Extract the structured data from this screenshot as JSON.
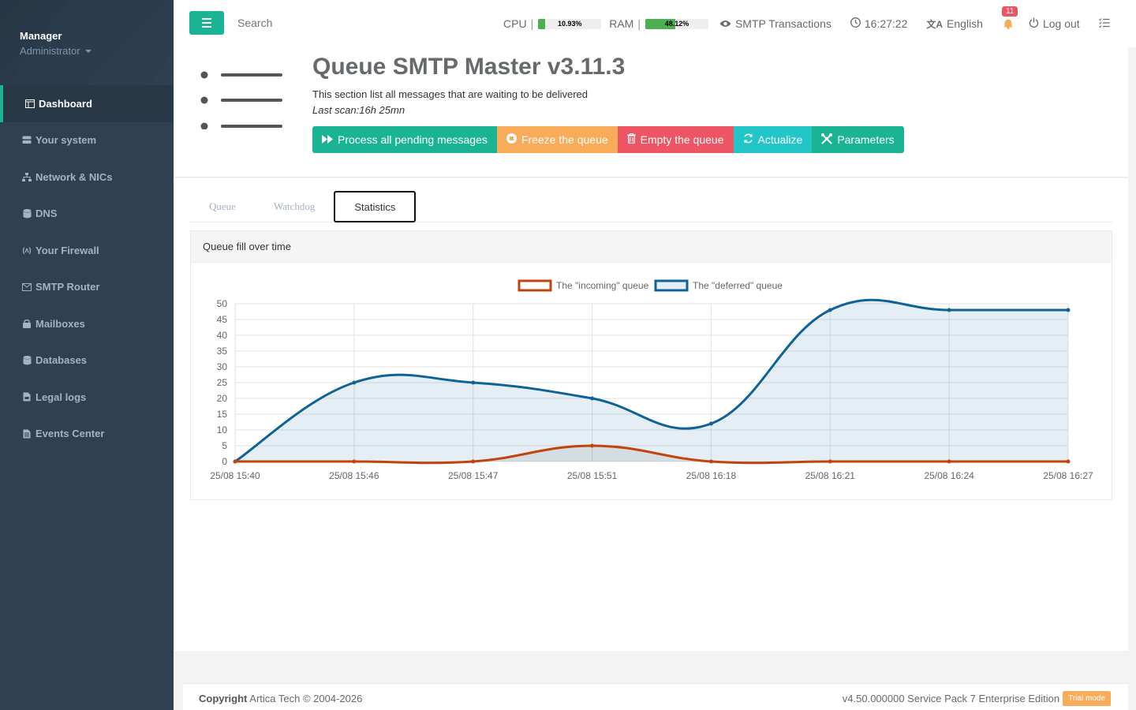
{
  "sidebar": {
    "user_name": "Manager",
    "user_role": "Administrator",
    "items": [
      {
        "label": "Dashboard",
        "icon": "dashboard-icon"
      },
      {
        "label": "Your system",
        "icon": "server-icon"
      },
      {
        "label": "Network & NICs",
        "icon": "network-icon"
      },
      {
        "label": "DNS",
        "icon": "database-icon"
      },
      {
        "label": "Your Firewall",
        "icon": "firewall-icon"
      },
      {
        "label": "SMTP Router",
        "icon": "envelope-icon"
      },
      {
        "label": "Mailboxes",
        "icon": "mailbox-icon"
      },
      {
        "label": "Databases",
        "icon": "database-icon"
      },
      {
        "label": "Legal logs",
        "icon": "file-icon"
      },
      {
        "label": "Events Center",
        "icon": "document-icon"
      }
    ]
  },
  "topbar": {
    "search_placeholder": "Search",
    "cpu_label": "CPU",
    "cpu_value": "10.93%",
    "cpu_fraction": 0.1093,
    "ram_label": "RAM",
    "ram_value": "48.12%",
    "ram_fraction": 0.4812,
    "smtp_transactions": "SMTP Transactions",
    "time": "16:27:22",
    "language": "English",
    "notifications": "11",
    "logout": "Log out"
  },
  "header": {
    "title": "Queue SMTP Master v3.11.3",
    "subtitle": "This section list all messages that are waiting to be delivered",
    "last_scan": "Last scan:16h 25mn",
    "actions": {
      "process": "Process all pending messages",
      "freeze": "Freeze the queue",
      "empty": "Empty the queue",
      "actualize": "Actualize",
      "parameters": "Parameters"
    }
  },
  "tabs": [
    "Queue",
    "Watchdog",
    "Statistics"
  ],
  "panel_title": "Queue fill over time",
  "chart_data": {
    "type": "line",
    "categories": [
      "25/08 15:40",
      "25/08 15:46",
      "25/08 15:47",
      "25/08 15:51",
      "25/08 16:18",
      "25/08 16:21",
      "25/08 16:24",
      "25/08 16:27"
    ],
    "series": [
      {
        "name": "The \"incoming\" queue",
        "values": [
          0,
          0,
          0,
          5,
          0,
          0,
          0,
          0
        ],
        "color": "#c0440c",
        "fill": "rgba(0,0,0,0.07)"
      },
      {
        "name": "The \"deferred\" queue",
        "values": [
          0,
          25,
          25,
          20,
          12,
          48,
          48,
          48
        ],
        "color": "#0d6397",
        "fill": "rgba(13,99,151,0.11)"
      }
    ],
    "ylim": [
      0,
      50
    ],
    "yticks": [
      0,
      5,
      10,
      15,
      20,
      25,
      30,
      35,
      40,
      45,
      50
    ],
    "grid": true,
    "legend": "top-center"
  },
  "footer": {
    "copyright_label": "Copyright",
    "copyright_text": "Artica Tech © 2004-2026",
    "version": "v4.50.000000 Service Pack 7 Enterprise Edition",
    "trial": "Trial mode"
  }
}
